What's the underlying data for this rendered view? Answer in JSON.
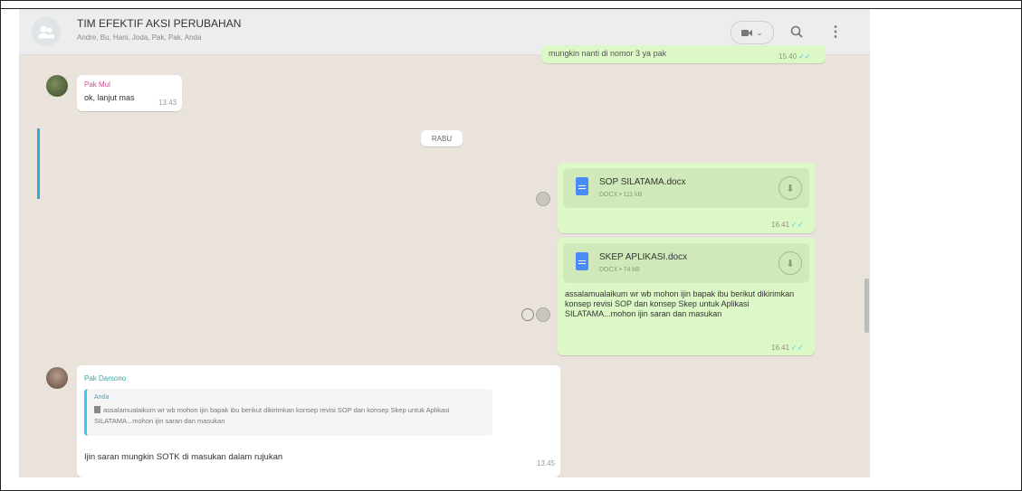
{
  "header": {
    "title": "TIM EFEKTIF AKSI PERUBAHAN",
    "participants": "Andre, Bu, Hani, Joda, Pak, Pak, Anda"
  },
  "messages": {
    "top_partial": {
      "text": "mungkin nanti di nomor 3 ya pak",
      "time": "15.40"
    },
    "pak_mul": {
      "sender": "Pak Mul",
      "text": "ok, lanjut mas",
      "time": "13.43"
    },
    "date_divider": "RABU",
    "doc1": {
      "name": "SOP SILATAMA.docx",
      "meta": "DOCX • 111 kB",
      "time": "16.41"
    },
    "doc2": {
      "name": "SKEP APLIKASI.docx",
      "meta": "DOCX • 74 kB",
      "caption": "assalamualaikum wr wb mohon ijin bapak ibu berikut dikirimkan konsep revisi SOP dan konsep Skep untuk Aplikasi SILATAMA...mohon ijin saran dan masukan",
      "time": "16.41"
    },
    "reply": {
      "sender": "Pak Darsono",
      "quote_author": "Anda",
      "quote_text": "assalamualaikum wr wb mohon ijin bapak ibu berikut dikirimkan konsep revisi SOP dan konsep Skep untuk Aplikasi SILATAMA...mohon ijin saran dan masukan",
      "text": "Ijin saran mungkin SOTK di masukan dalam rujukan",
      "time": "13.45"
    }
  },
  "colors": {
    "outgoing": "#dcf8c6",
    "incoming": "#ffffff",
    "background": "#e9e3db",
    "read_ticks": "#4fc3f7",
    "doc_icon": "#4a8cf7"
  },
  "icons": {
    "video": "video-camera-icon",
    "search": "search-icon",
    "menu": "kebab-menu-icon",
    "download": "download-icon",
    "forward": "forward-icon"
  }
}
